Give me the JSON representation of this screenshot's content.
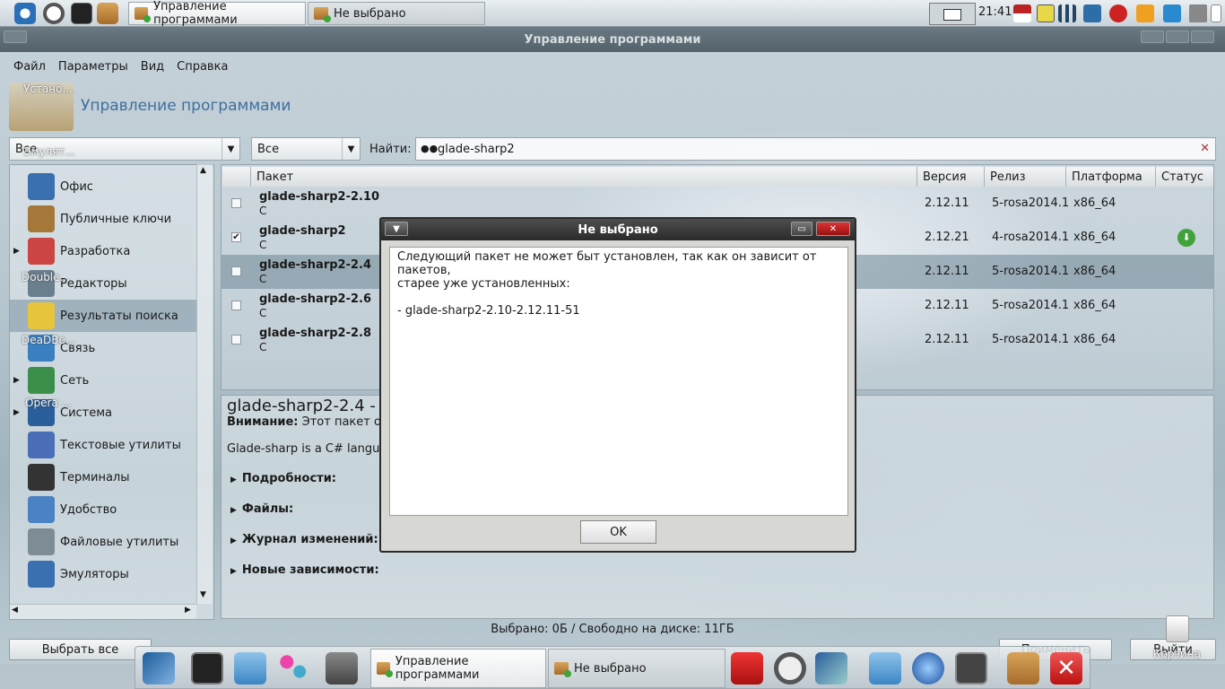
{
  "top_panel": {
    "tasks": [
      {
        "label": "Управление программами",
        "active": true
      },
      {
        "label": "Не выбрано",
        "active": false
      }
    ],
    "clock": "21:41"
  },
  "window": {
    "title": "Управление программами"
  },
  "menu": [
    "Файл",
    "Параметры",
    "Вид",
    "Справка"
  ],
  "header": {
    "title": "Управление программами"
  },
  "filters": {
    "group": "Все",
    "status": "Все",
    "find_label": "Найти:",
    "search_value": "glade-sharp2"
  },
  "categories": [
    {
      "label": "Офис",
      "expandable": false,
      "selected": false
    },
    {
      "label": "Публичные ключи",
      "expandable": false,
      "selected": false
    },
    {
      "label": "Разработка",
      "expandable": true,
      "selected": false
    },
    {
      "label": "Редакторы",
      "expandable": false,
      "selected": false
    },
    {
      "label": "Результаты поиска",
      "expandable": false,
      "selected": true
    },
    {
      "label": "Связь",
      "expandable": false,
      "selected": false
    },
    {
      "label": "Сеть",
      "expandable": true,
      "selected": false
    },
    {
      "label": "Система",
      "expandable": true,
      "selected": false
    },
    {
      "label": "Текстовые утилиты",
      "expandable": false,
      "selected": false
    },
    {
      "label": "Терминалы",
      "expandable": false,
      "selected": false
    },
    {
      "label": "Удобство",
      "expandable": false,
      "selected": false
    },
    {
      "label": "Файловые утилиты",
      "expandable": false,
      "selected": false
    },
    {
      "label": "Эмуляторы",
      "expandable": false,
      "selected": false
    }
  ],
  "columns": [
    "Пакет",
    "Версия",
    "Релиз",
    "Платформа",
    "Статус"
  ],
  "packages": [
    {
      "name": "glade-sharp2-2.10",
      "summary": "C",
      "version": "2.12.11",
      "release": "5-rosa2014.1",
      "platform": "x86_64",
      "checked": false,
      "installed": false
    },
    {
      "name": "glade-sharp2",
      "summary": "C",
      "version": "2.12.21",
      "release": "4-rosa2014.1",
      "platform": "x86_64",
      "checked": true,
      "installed": true
    },
    {
      "name": "glade-sharp2-2.4",
      "summary": "C",
      "version": "2.12.11",
      "release": "5-rosa2014.1",
      "platform": "x86_64",
      "checked": false,
      "installed": false
    },
    {
      "name": "glade-sharp2-2.6",
      "summary": "C",
      "version": "2.12.11",
      "release": "5-rosa2014.1",
      "platform": "x86_64",
      "checked": false,
      "installed": false
    },
    {
      "name": "glade-sharp2-2.8",
      "summary": "C",
      "version": "2.12.11",
      "release": "5-rosa2014.1",
      "platform": "x86_64",
      "checked": false,
      "installed": false
    }
  ],
  "details": {
    "title": "glade-sharp2-2.4 - C",
    "warning_label": "Внимание:",
    "warning_text": " Этот пакет офи",
    "description": "Glade-sharp is a C# language",
    "sections": [
      "Подробности:",
      "Файлы:",
      "Журнал изменений:",
      "Новые зависимости:"
    ]
  },
  "status_text": "Выбрано: 0Б / Свободно на диске: 11ГБ",
  "buttons": {
    "select_all": "Выбрать все",
    "apply": "Применить",
    "quit": "Выйти"
  },
  "desktop_labels": [
    "Устано...",
    "Эмулят...",
    "Double...",
    "DeaDBe...",
    "Opera ...",
    "Корзина"
  ],
  "dock_tasks": [
    {
      "label": "Управление программами"
    },
    {
      "label": "Не выбрано"
    }
  ],
  "dialog": {
    "title": "Не выбрано",
    "line1": "Следующий пакет не может быт установлен, так как он зависит от пакетов,",
    "line2": "старее уже установленных:",
    "line3": "- glade-sharp2-2.10-2.12.11-51",
    "ok": "OK"
  },
  "colors": {
    "accent": "#3f6fa0",
    "selection": "#6e8796",
    "install_green": "#3fa33a"
  }
}
